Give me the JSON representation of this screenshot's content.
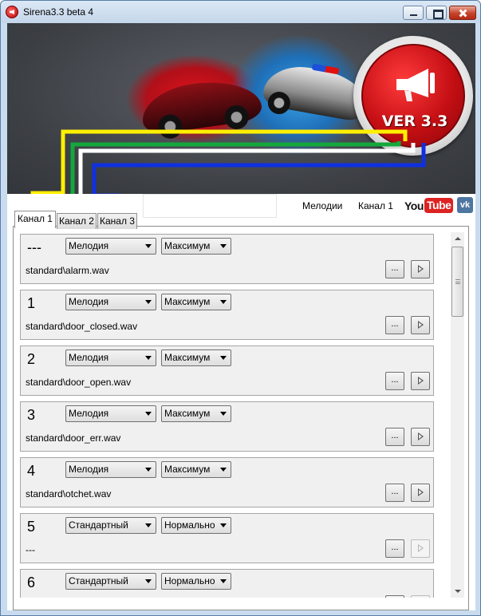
{
  "window": {
    "title": "Sirena3.3 beta 4"
  },
  "banner": {
    "version_text": "VER 3.3",
    "wire_colors": [
      "#ffef00",
      "#14a73c",
      "#ffffff",
      "#1030e0"
    ]
  },
  "header": {
    "links": [
      "Мелодии",
      "Канал 1"
    ],
    "youtube": {
      "you": "You",
      "tube": "Tube"
    },
    "vk": "vk"
  },
  "tabs": [
    {
      "label": "Канал 1",
      "active": true
    },
    {
      "label": "Канал 2",
      "active": false
    },
    {
      "label": "Канал 3",
      "active": false
    }
  ],
  "rows": [
    {
      "num": "---",
      "type": "Мелодия",
      "volume": "Максимум",
      "file": "standard\\alarm.wav",
      "browse": "...",
      "play_enabled": true
    },
    {
      "num": "1",
      "type": "Мелодия",
      "volume": "Максимум",
      "file": "standard\\door_closed.wav",
      "browse": "...",
      "play_enabled": true
    },
    {
      "num": "2",
      "type": "Мелодия",
      "volume": "Максимум",
      "file": "standard\\door_open.wav",
      "browse": "...",
      "play_enabled": true
    },
    {
      "num": "3",
      "type": "Мелодия",
      "volume": "Максимум",
      "file": "standard\\door_err.wav",
      "browse": "...",
      "play_enabled": true
    },
    {
      "num": "4",
      "type": "Мелодия",
      "volume": "Максимум",
      "file": "standard\\otchet.wav",
      "browse": "...",
      "play_enabled": true
    },
    {
      "num": "5",
      "type": "Стандартный",
      "volume": "Нормально",
      "file": "---",
      "browse": "...",
      "play_enabled": false
    },
    {
      "num": "6",
      "type": "Стандартный",
      "volume": "Нормально",
      "file": "",
      "browse": "...",
      "play_enabled": false
    }
  ]
}
